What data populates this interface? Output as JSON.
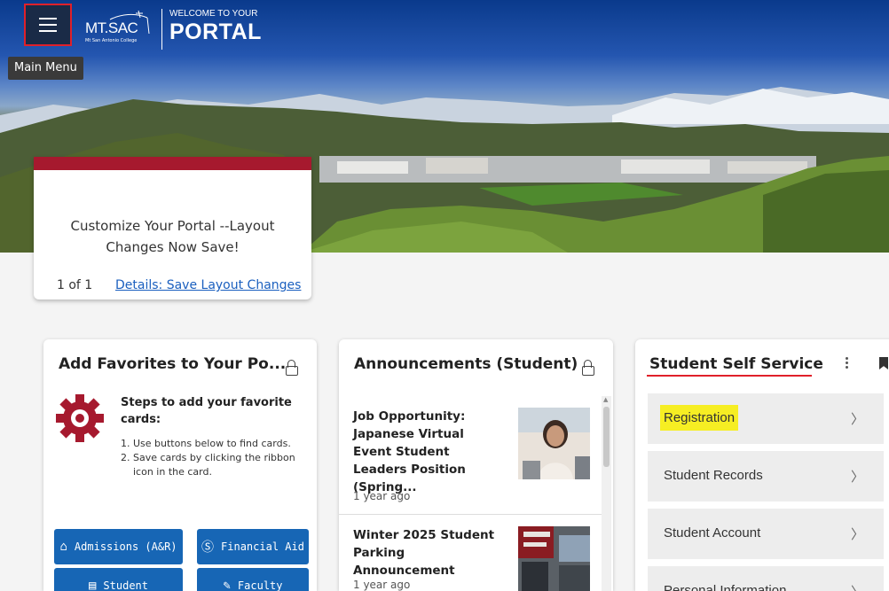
{
  "header": {
    "menu_tooltip": "Main Menu",
    "logo_name": "MT.SAC",
    "logo_sub": "Mt San Antonio College",
    "welcome": "WELCOME TO YOUR",
    "portal": "PORTAL"
  },
  "notice": {
    "text": "Customize Your Portal --Layout Changes Now Save!",
    "count": "1 of 1",
    "link": "Details: Save Layout Changes"
  },
  "favorites": {
    "title": "Add Favorites to Your Po...",
    "steps_title": "Steps to add your favorite cards:",
    "steps": [
      "1. Use buttons below to find cards.",
      "2. Save cards by clicking the ribbon icon in the card."
    ],
    "buttons": [
      "Admissions (A&R)",
      "Financial Aid",
      "Student",
      "Faculty"
    ]
  },
  "announcements": {
    "title": "Announcements (Student)",
    "items": [
      {
        "headline": "Job Opportunity: Japanese Virtual Event Student Leaders Position (Spring...",
        "time": "1 year ago"
      },
      {
        "headline": "Winter 2025 Student Parking Announcement",
        "time": "1 year ago"
      }
    ]
  },
  "self_service": {
    "title": "Student Self Service",
    "items": [
      "Registration",
      "Student Records",
      "Student Account",
      "Personal Information"
    ]
  },
  "colors": {
    "brand_red": "#a6192e",
    "button_blue": "#1766b5",
    "highlight": "#f6ee23"
  },
  "icons": [
    "menu-icon",
    "lock-icon",
    "gear-icon",
    "kebab-icon",
    "bookmark-icon",
    "chevron-right-icon",
    "building-icon",
    "dollar-icon",
    "id-card-icon",
    "pen-icon"
  ]
}
